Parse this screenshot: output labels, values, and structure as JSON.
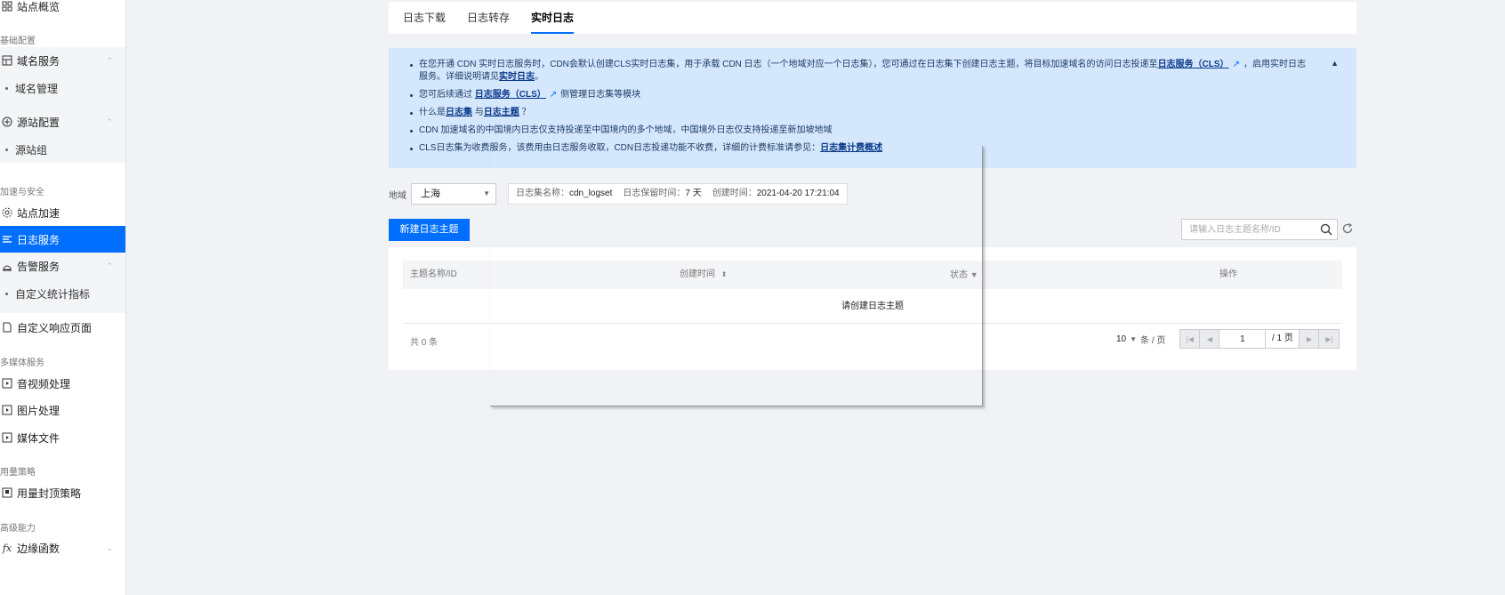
{
  "sidebar": {
    "top_item": "站点概览",
    "sections": {
      "basic": "基础配置",
      "accel": "加速与安全",
      "media": "多媒体服务",
      "usage": "用量策略",
      "advanced": "高级能力"
    },
    "items": {
      "domain_service": "域名服务",
      "domain_manage": "域名管理",
      "origin_config": "源站配置",
      "origin_group": "源站组",
      "site_accel": "站点加速",
      "log_service": "日志服务",
      "alarm_service": "告警服务",
      "custom_metrics": "自定义统计指标",
      "custom_page": "自定义响应页面",
      "av_processing": "音视频处理",
      "image_processing": "图片处理",
      "media_files": "媒体文件",
      "usage_cap": "用量封顶策略",
      "edge_functions": "边缘函数"
    }
  },
  "tabs": [
    "日志下载",
    "日志转存",
    "实时日志"
  ],
  "active_tab": 2,
  "banner": {
    "l1_a": "在您开通 CDN 实时日志服务时，CDN会默认创建CLS实时日志集，用于承载 CDN 日志（一个地域对应一个日志集），您可通过在日志集下创建日志主题，将目标加速域名的访问日志投递至",
    "l1_link": "日志服务（CLS）",
    "l1_b": "，启用实时日志服务。详细说明请见",
    "l1_link2": "实时日志",
    "l1_c": "。",
    "l2_a": "您可后续通过",
    "l2_link": "日志服务（CLS）",
    "l2_b": "侧管理日志集等模块",
    "l3_a": "什么是",
    "l3_link1": "日志集",
    "l3_b": "与",
    "l3_link2": "日志主题",
    "l3_c": "？",
    "l4": "CDN 加速域名的中国境内日志仅支持投递至中国境内的多个地域，中国境外日志仅支持投递至新加坡地域",
    "l5_a": "CLS日志集为收费服务，该费用由日志服务收取，CDN日志投递功能不收费，详细的计费标准请参见：",
    "l5_link": "日志集计费概述"
  },
  "filter": {
    "region_label": "地域",
    "region_value": "上海",
    "logset_label": "日志集名称：",
    "logset_value": "cdn_logset",
    "retention_label": "日志保留时间：",
    "retention_value": "7 天",
    "created_label": "创建时间：",
    "created_value": "2021-04-20 17:21:04"
  },
  "actions": {
    "new_topic": "新建日志主题",
    "search_placeholder": "请输入日志主题名称/ID"
  },
  "table": {
    "columns": [
      "主题名称/ID",
      "创建时间",
      "状态",
      "操作"
    ],
    "empty_text": "请创建日志主题",
    "total": "共 0 条",
    "page_size": "10",
    "page_size_unit": "条 / 页",
    "current_page": "1",
    "total_pages": "/ 1 页"
  }
}
